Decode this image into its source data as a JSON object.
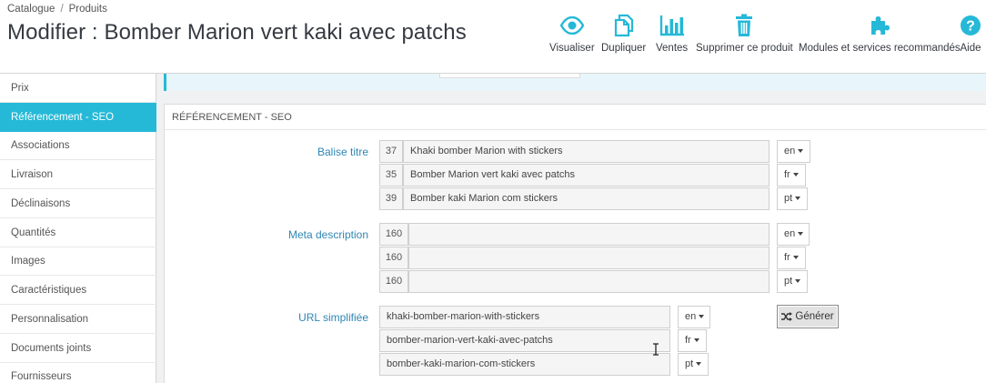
{
  "breadcrumb": {
    "item1": "Catalogue",
    "separator": "/",
    "item2": "Produits"
  },
  "page": {
    "title": "Modifier : Bomber Marion vert kaki avec patchs"
  },
  "toolbar": {
    "preview": "Visualiser",
    "duplicate": "Dupliquer",
    "sales": "Ventes",
    "delete": "Supprimer ce produit",
    "modules": "Modules et services recommandés",
    "help": "Aide",
    "icon_color": "#25b9d7"
  },
  "sidebar": {
    "items": [
      {
        "label": "Prix"
      },
      {
        "label": "Référencement - SEO"
      },
      {
        "label": "Associations"
      },
      {
        "label": "Livraison"
      },
      {
        "label": "Déclinaisons"
      },
      {
        "label": "Quantités"
      },
      {
        "label": "Images"
      },
      {
        "label": "Caractéristiques"
      },
      {
        "label": "Personnalisation"
      },
      {
        "label": "Documents joints"
      },
      {
        "label": "Fournisseurs"
      }
    ],
    "active_color": "#25b9d7"
  },
  "panel": {
    "heading": "Référencement - SEO"
  },
  "seo_title": {
    "label": "Balise titre",
    "rows": [
      {
        "count": "37",
        "value": "Khaki bomber Marion with stickers",
        "lang": "en"
      },
      {
        "count": "35",
        "value": "Bomber Marion vert kaki avec patchs",
        "lang": "fr"
      },
      {
        "count": "39",
        "value": "Bomber kaki Marion com stickers",
        "lang": "pt"
      }
    ]
  },
  "meta_description": {
    "label": "Meta description",
    "rows": [
      {
        "count": "160",
        "value": "",
        "lang": "en"
      },
      {
        "count": "160",
        "value": "",
        "lang": "fr"
      },
      {
        "count": "160",
        "value": "",
        "lang": "pt"
      }
    ]
  },
  "friendly_url": {
    "label": "URL simplifiée",
    "rows": [
      {
        "value": "khaki-bomber-marion-with-stickers",
        "lang": "en"
      },
      {
        "value": "bomber-marion-vert-kaki-avec-patchs",
        "lang": "fr"
      },
      {
        "value": "bomber-kaki-marion-com-stickers",
        "lang": "pt"
      }
    ],
    "generate_label": "Générer"
  }
}
